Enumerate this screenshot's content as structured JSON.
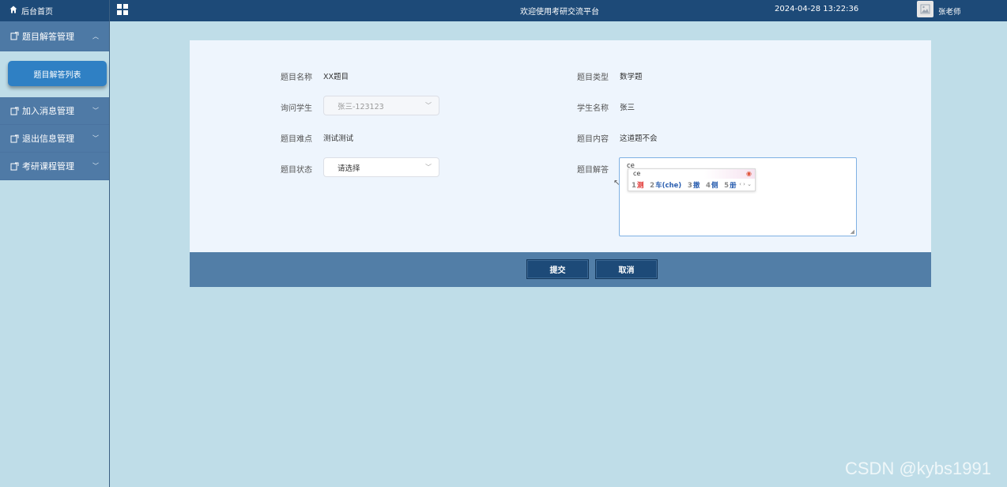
{
  "sidebar": {
    "home_label": "后台首页",
    "menus": [
      {
        "label": "题目解答管理",
        "expanded": true,
        "children": [
          {
            "label": "题目解答列表"
          }
        ]
      },
      {
        "label": "加入消息管理",
        "expanded": false
      },
      {
        "label": "退出信息管理",
        "expanded": false
      },
      {
        "label": "考研课程管理",
        "expanded": false
      }
    ]
  },
  "header": {
    "title": "欢迎使用考研交流平台",
    "datetime": "2024-04-28 13:22:36",
    "username": "张老师"
  },
  "form": {
    "fields": {
      "name": {
        "label": "题目名称",
        "value": "XX题目"
      },
      "type": {
        "label": "题目类型",
        "value": "数学题"
      },
      "student_select": {
        "label": "询问学生",
        "value": "张三-123123"
      },
      "student_name": {
        "label": "学生名称",
        "value": "张三"
      },
      "difficulty": {
        "label": "题目难点",
        "value": "测试测试"
      },
      "content": {
        "label": "题目内容",
        "value": "这道题不会"
      },
      "status": {
        "label": "题目状态",
        "value": "请选择"
      },
      "answer": {
        "label": "题目解答",
        "value": "ce"
      }
    },
    "submit_label": "提交",
    "cancel_label": "取消"
  },
  "ime": {
    "typed": "ce",
    "candidates": [
      {
        "num": "1",
        "text": "测"
      },
      {
        "num": "2",
        "text": "车(che)"
      },
      {
        "num": "3",
        "text": "撤"
      },
      {
        "num": "4",
        "text": "侧"
      },
      {
        "num": "5",
        "text": "册"
      }
    ]
  },
  "watermark": "CSDN @kybs1991",
  "colors": {
    "header_bg": "#1d4a78",
    "menu_bg": "#4f7aa6",
    "active_item": "#2f80c4",
    "page_bg": "#bfdde8",
    "panel_bg": "#eef5fd",
    "footer_bar": "#527ea7"
  }
}
